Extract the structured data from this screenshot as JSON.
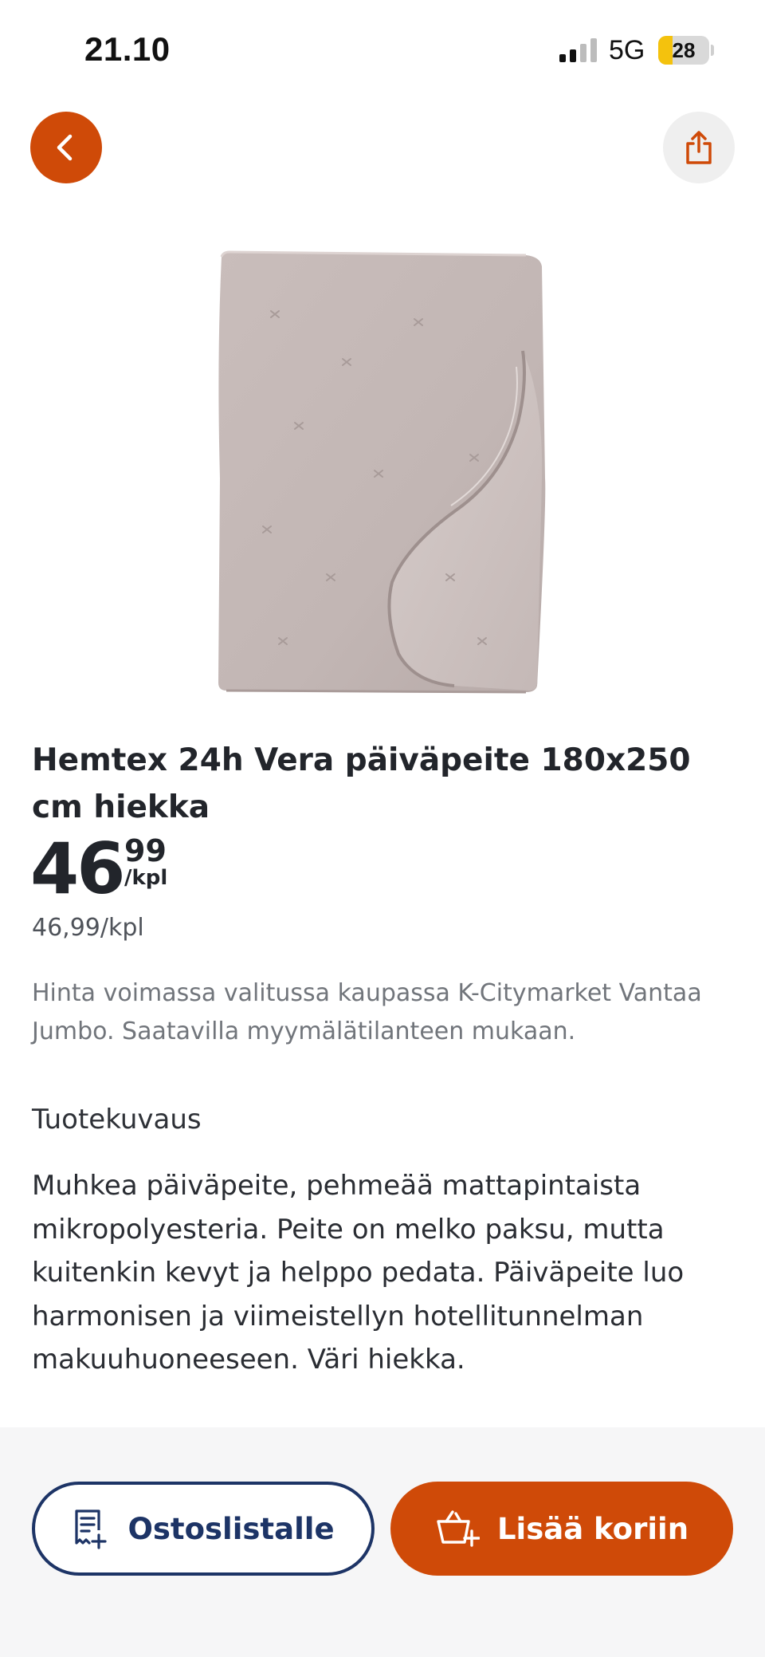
{
  "status_bar": {
    "time": "21.10",
    "network": "5G",
    "battery_level": "28",
    "signal_icon": "cellular-signal-icon"
  },
  "top_actions": {
    "back_icon": "chevron-left-icon",
    "share_icon": "share-icon"
  },
  "product": {
    "image_icon": "bedspread-image",
    "title": "Hemtex 24h Vera päiväpeite 180x250 cm hiekka",
    "price_euros": "46",
    "price_cents": "99",
    "price_unit": "/kpl",
    "unit_price": "46,99/kpl",
    "price_note": "Hinta voimassa valitussa kaupassa K-Citymarket Vantaa Jumbo. Saatavilla myymälätilanteen mukaan.",
    "description_heading": "Tuotekuvaus",
    "description": "Muhkea päiväpeite, pehmeää mattapintaista mikropolyesteria. Peite on melko paksu, mutta kuitenkin kevyt ja helppo pedata. Päiväpeite luo harmonisen ja viimeistellyn hotellitunnelman makuuhuoneeseen. Väri hiekka."
  },
  "actions": {
    "shopping_list_label": "Ostoslistalle",
    "shopping_list_icon": "shopping-list-add-icon",
    "add_to_cart_label": "Lisää koriin",
    "add_to_cart_icon": "cart-add-icon"
  },
  "colors": {
    "accent": "#cf4a08",
    "navy": "#1d3466",
    "bottom_bar_bg": "#f6f6f7"
  }
}
